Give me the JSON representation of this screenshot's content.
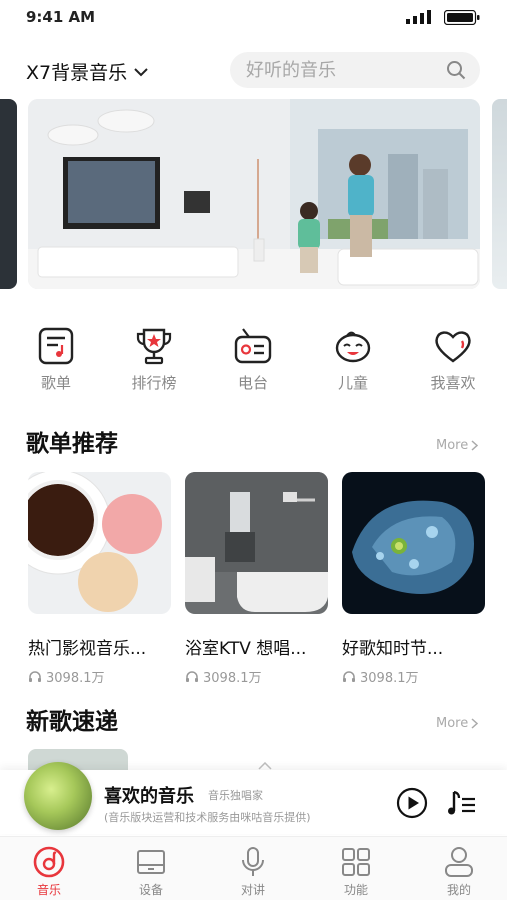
{
  "status_bar": {
    "time": "9:41 AM"
  },
  "header": {
    "device_name": "X7背景音乐",
    "search_placeholder": "好听的音乐"
  },
  "quick_menu": [
    {
      "label": "歌单",
      "icon": "playlist-icon"
    },
    {
      "label": "排行榜",
      "icon": "trophy-icon"
    },
    {
      "label": "电台",
      "icon": "radio-icon"
    },
    {
      "label": "儿童",
      "icon": "child-face-icon"
    },
    {
      "label": "我喜欢",
      "icon": "heart-icon"
    }
  ],
  "playlist_section": {
    "title": "歌单推荐",
    "more": "More",
    "items": [
      {
        "name": "热门影视音乐...",
        "plays": "3098.1万"
      },
      {
        "name": "浴室KTV 想唱...",
        "plays": "3098.1万"
      },
      {
        "name": "好歌知时节...",
        "plays": "3098.1万"
      }
    ]
  },
  "new_songs_section": {
    "title": "新歌速递",
    "more": "More"
  },
  "player": {
    "title": "喜欢的音乐",
    "subtitle": "音乐独唱家",
    "note": "(音乐版块运营和技术服务由咪咕音乐提供)"
  },
  "tabs": [
    {
      "label": "音乐",
      "active": true
    },
    {
      "label": "设备",
      "active": false
    },
    {
      "label": "对讲",
      "active": false
    },
    {
      "label": "功能",
      "active": false
    },
    {
      "label": "我的",
      "active": false
    }
  ],
  "colors": {
    "accent": "#e8363c",
    "text": "#111111",
    "muted": "#999999"
  }
}
